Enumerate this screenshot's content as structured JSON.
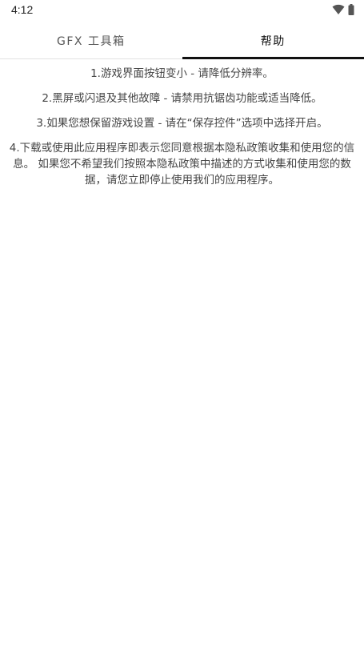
{
  "status_bar": {
    "time": "4:12",
    "icons": [
      "wifi-icon",
      "battery-icon"
    ]
  },
  "tabs": [
    {
      "label": "GFX 工具箱",
      "active": false
    },
    {
      "label": "帮助",
      "active": true
    }
  ],
  "help": {
    "lines": [
      "1.游戏界面按钮变小 - 请降低分辨率。",
      "2.黑屏或闪退及其他故障 - 请禁用抗锯齿功能或适当降低。",
      "3.如果您想保留游戏设置 - 请在“保存控件”选项中选择开启。",
      "4.下载或使用此应用程序即表示您同意根据本隐私政策收集和使用您的信息。 如果您不希望我们按照本隐私政策中描述的方式收集和使用您的数据，请您立即停止使用我们的应用程序。"
    ]
  },
  "colors": {
    "background": "#ffffff",
    "indicator": "#111111",
    "text": "#444444"
  }
}
